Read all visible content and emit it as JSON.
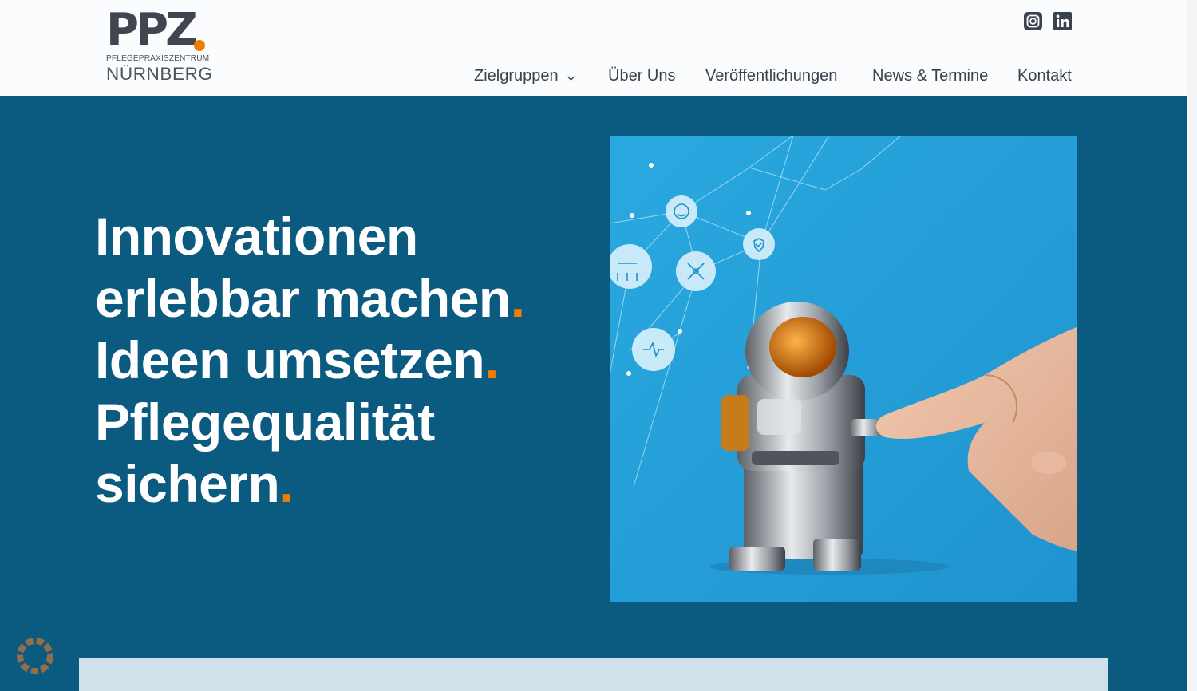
{
  "header": {
    "logo": {
      "wordmark": "PPZ",
      "subtitle": "PFLEGEPRAXISZENTRUM",
      "city": "NÜRNBERG"
    },
    "social": [
      {
        "icon": "instagram-icon"
      },
      {
        "icon": "linkedin-icon"
      }
    ],
    "nav": [
      {
        "label": "Zielgruppen",
        "has_dropdown": true
      },
      {
        "label": "Über Uns"
      },
      {
        "label": "Veröffentlichungen"
      },
      {
        "label": "News & Termine"
      },
      {
        "label": "Kontakt"
      }
    ]
  },
  "hero": {
    "lines": [
      "Innovationen",
      "erlebbar machen",
      "Ideen umsetzen",
      "Pflegequalität",
      "sichern"
    ],
    "accent": "."
  },
  "colors": {
    "primary_blue": "#0b5a80",
    "accent_orange": "#ef7d00",
    "header_bg": "#fbfcfd",
    "panel_light": "#cfe1e9"
  }
}
